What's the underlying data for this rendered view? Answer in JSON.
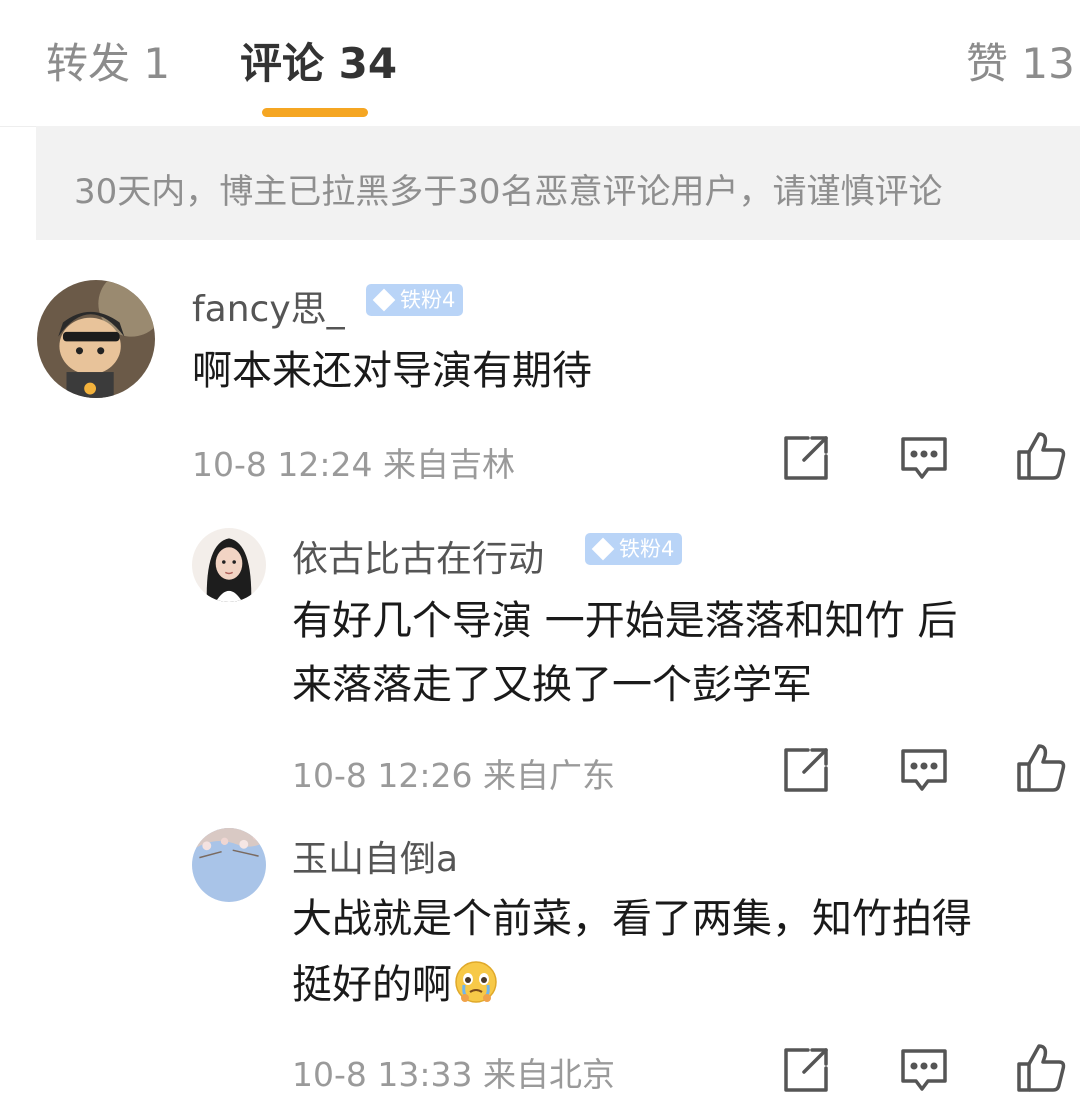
{
  "tabs": {
    "repost": "转发 1",
    "comments": "评论 34",
    "likes": "赞 13"
  },
  "notice": "30天内，博主已拉黑多于30名恶意评论用户，请谨慎评论",
  "comments": [
    {
      "username": "fancy思_",
      "badge": "铁粉4",
      "text": "啊本来还对导演有期待",
      "time": "10-8 12:24",
      "location": "来自吉林"
    },
    {
      "username": "依古比古在行动",
      "badge": "铁粉4",
      "text_line1": "有好几个导演 一开始是落落和知竹 后",
      "text_line2": "来落落走了又换了一个彭学军",
      "time": "10-8 12:26",
      "location": "来自广东"
    },
    {
      "username": "玉山自倒a",
      "text_line1": "大战就是个前菜，看了两集，知竹拍得",
      "text_line2": "挺好的啊",
      "time": "10-8 13:33",
      "location": "来自北京"
    }
  ],
  "icons": {
    "share": "share-icon",
    "comment": "comment-icon",
    "like": "thumbs-up-icon",
    "emoji": "teary-emoji-icon"
  },
  "colors": {
    "accent": "#f5a623",
    "badge": "#b9d4f7",
    "meta": "#9a9a9a"
  }
}
